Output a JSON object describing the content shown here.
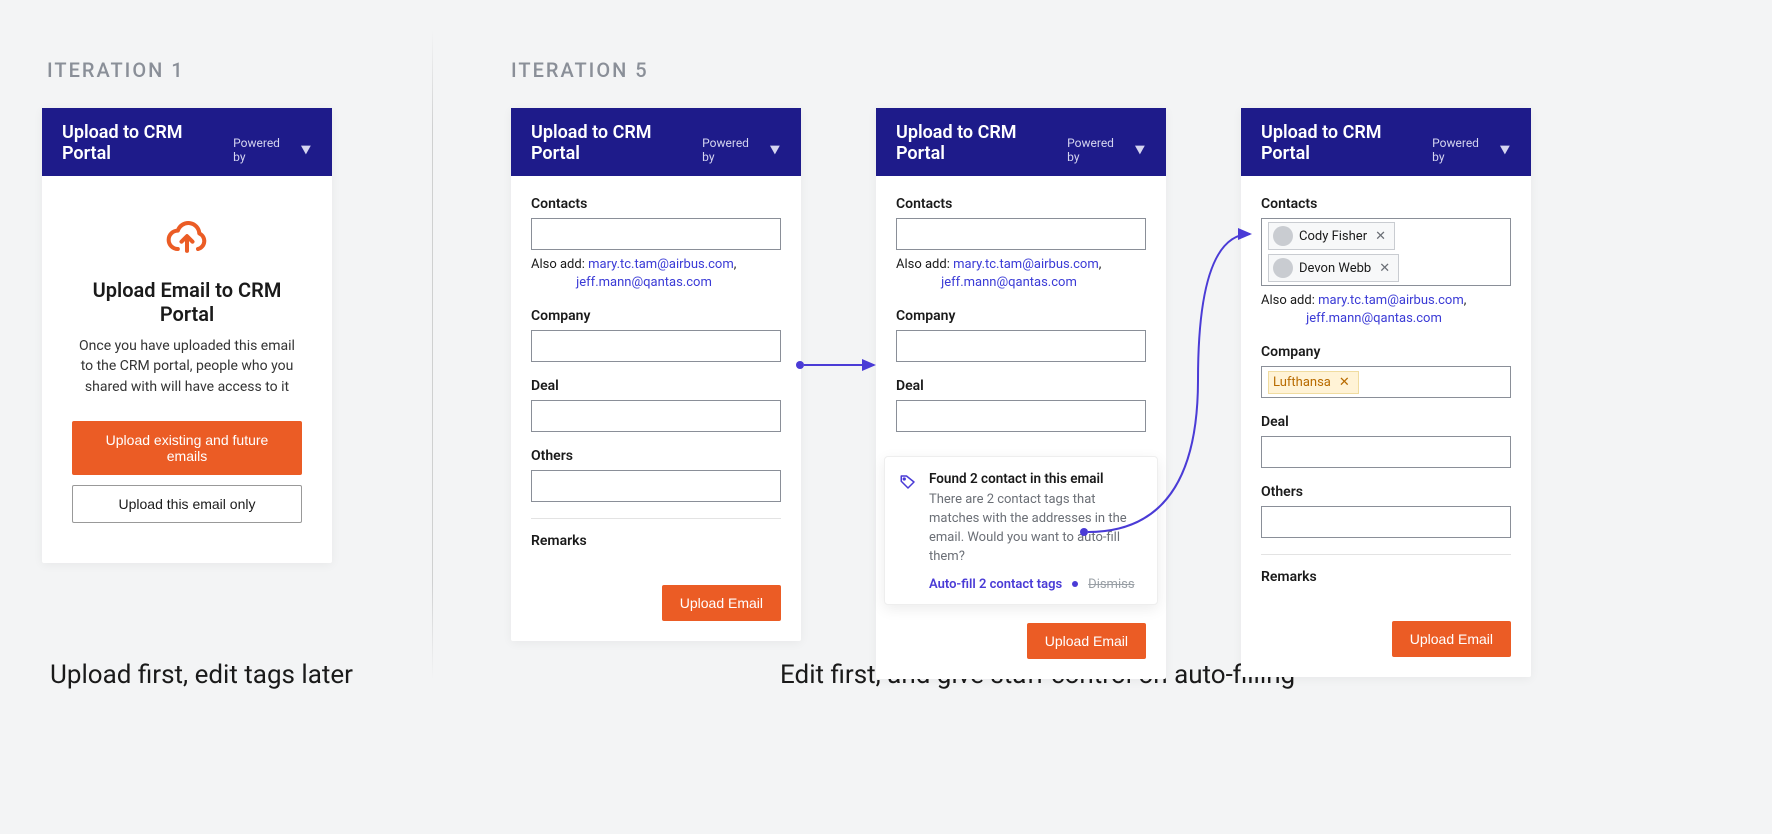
{
  "iterations": {
    "label1": "ITERATION 1",
    "label5": "ITERATION 5",
    "caption1": "Upload first, edit tags later",
    "caption5": "Edit first, and give staff control on auto-filling"
  },
  "header": {
    "title": "Upload to CRM Portal",
    "powered_by": "Powered by"
  },
  "card1": {
    "title": "Upload Email to CRM Portal",
    "desc": "Once you have uploaded this email to the CRM portal, people who you shared with will have access to it",
    "btn_primary": "Upload existing and future emails",
    "btn_secondary": "Upload this email only"
  },
  "form": {
    "contacts_label": "Contacts",
    "company_label": "Company",
    "deal_label": "Deal",
    "others_label": "Others",
    "remarks_label": "Remarks",
    "also_add_label": "Also add:",
    "also_add_email1": "mary.tc.tam@airbus.com",
    "also_add_email2": "jeff.mann@qantas.com",
    "upload_btn": "Upload Email"
  },
  "hint": {
    "title": "Found 2 contact in this email",
    "body": "There are 2 contact tags that matches with the addresses in the email. Would you want to auto-fill them?",
    "action_primary": "Auto-fill 2 contact tags",
    "action_dismiss": "Dismiss"
  },
  "chips": {
    "contact1": "Cody Fisher",
    "contact2": "Devon Webb",
    "company1": "Lufthansa"
  }
}
